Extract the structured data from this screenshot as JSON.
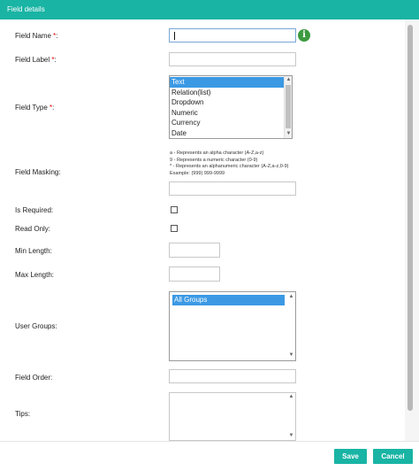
{
  "dialog": {
    "title": "Field details"
  },
  "form": {
    "field_name": {
      "label": "Field Name ",
      "required_mark": "*",
      "colon": ":",
      "value": ""
    },
    "field_label": {
      "label": "Field Label ",
      "required_mark": "*",
      "colon": ":",
      "value": ""
    },
    "field_type": {
      "label": "Field Type ",
      "required_mark": "*",
      "colon": ":",
      "options": [
        "Text",
        "Relation(list)",
        "Dropdown",
        "Numeric",
        "Currency",
        "Date"
      ],
      "selected": "Text"
    },
    "field_masking": {
      "label": "Field Masking:",
      "hints": [
        "a - Represents an alpha character (A-Z,a-z)",
        "9 - Represents a numeric character (0-9)",
        "* - Represents an alphanumeric character (A-Z,a-z,0-9)",
        "Example: (999) 999-9999"
      ],
      "value": ""
    },
    "is_required": {
      "label": "Is Required:",
      "checked": false
    },
    "read_only": {
      "label": "Read Only:",
      "checked": false
    },
    "min_length": {
      "label": "Min Length:",
      "value": ""
    },
    "max_length": {
      "label": "Max Length:",
      "value": ""
    },
    "user_groups": {
      "label": "User Groups:",
      "options": [
        "All Groups"
      ],
      "selected": "All Groups"
    },
    "field_order": {
      "label": "Field Order:",
      "value": ""
    },
    "tips": {
      "label": "Tips:",
      "value": ""
    }
  },
  "footer": {
    "save_label": "Save",
    "cancel_label": "Cancel"
  },
  "icons": {
    "info": "info-icon"
  },
  "colors": {
    "accent": "#19b4a4",
    "selection": "#3b99e4",
    "required": "#dd0000",
    "info_icon": "#3c9a3f"
  }
}
